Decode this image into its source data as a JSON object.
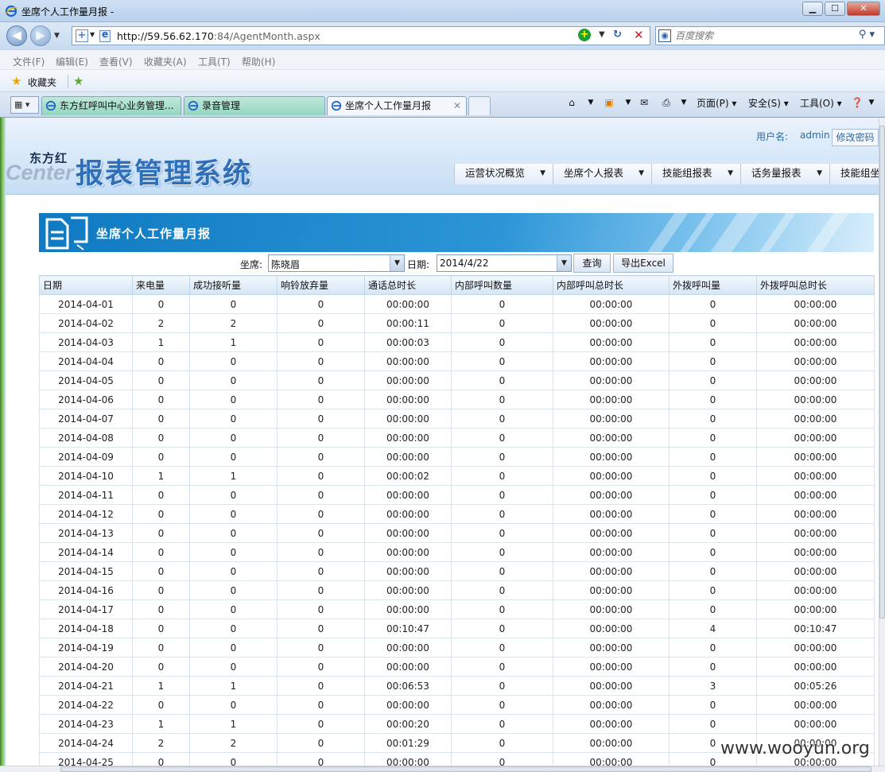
{
  "window": {
    "title": "坐席个人工作量月报 -",
    "min": "▁",
    "max": "☐",
    "close": "✕"
  },
  "address": {
    "url_host": "http://59.56.62.170",
    "url_rest": ":84/AgentMonth.aspx",
    "search_placeholder": "百度搜索"
  },
  "menu": [
    "文件(F)",
    "编辑(E)",
    "查看(V)",
    "收藏夹(A)",
    "工具(T)",
    "帮助(H)"
  ],
  "favorites": {
    "label": "收藏夹"
  },
  "tabs": [
    {
      "label": "东方红呼叫中心业务管理..."
    },
    {
      "label": "录音管理"
    },
    {
      "label": "坐席个人工作量月报"
    }
  ],
  "commands": {
    "page": "页面(P) ▾",
    "safety": "安全(S) ▾",
    "tools": "工具(O) ▾"
  },
  "header": {
    "logo_small": "东方红",
    "logo_center": "Center",
    "logo_main": "报表管理系统",
    "user_label": "用户名:",
    "user_name": "admin",
    "change_password": "修改密码",
    "nav": [
      "运营状况概览",
      "坐席个人报表",
      "技能组报表",
      "话务量报表",
      "技能组坐"
    ]
  },
  "banner": {
    "title": "坐席个人工作量月报"
  },
  "filter": {
    "agent_label": "坐席:",
    "agent_value": "陈晓眉",
    "date_label": "日期:",
    "date_value": "2014/4/22",
    "query_button": "查询",
    "export_button": "导出Excel"
  },
  "table": {
    "columns": [
      "日期",
      "来电量",
      "成功接听量",
      "响铃放弃量",
      "通话总时长",
      "内部呼叫数量",
      "内部呼叫总时长",
      "外拨呼叫量",
      "外拨呼叫总时长"
    ],
    "rows": [
      [
        "2014-04-01",
        "0",
        "0",
        "0",
        "00:00:00",
        "0",
        "00:00:00",
        "0",
        "00:00:00"
      ],
      [
        "2014-04-02",
        "2",
        "2",
        "0",
        "00:00:11",
        "0",
        "00:00:00",
        "0",
        "00:00:00"
      ],
      [
        "2014-04-03",
        "1",
        "1",
        "0",
        "00:00:03",
        "0",
        "00:00:00",
        "0",
        "00:00:00"
      ],
      [
        "2014-04-04",
        "0",
        "0",
        "0",
        "00:00:00",
        "0",
        "00:00:00",
        "0",
        "00:00:00"
      ],
      [
        "2014-04-05",
        "0",
        "0",
        "0",
        "00:00:00",
        "0",
        "00:00:00",
        "0",
        "00:00:00"
      ],
      [
        "2014-04-06",
        "0",
        "0",
        "0",
        "00:00:00",
        "0",
        "00:00:00",
        "0",
        "00:00:00"
      ],
      [
        "2014-04-07",
        "0",
        "0",
        "0",
        "00:00:00",
        "0",
        "00:00:00",
        "0",
        "00:00:00"
      ],
      [
        "2014-04-08",
        "0",
        "0",
        "0",
        "00:00:00",
        "0",
        "00:00:00",
        "0",
        "00:00:00"
      ],
      [
        "2014-04-09",
        "0",
        "0",
        "0",
        "00:00:00",
        "0",
        "00:00:00",
        "0",
        "00:00:00"
      ],
      [
        "2014-04-10",
        "1",
        "1",
        "0",
        "00:00:02",
        "0",
        "00:00:00",
        "0",
        "00:00:00"
      ],
      [
        "2014-04-11",
        "0",
        "0",
        "0",
        "00:00:00",
        "0",
        "00:00:00",
        "0",
        "00:00:00"
      ],
      [
        "2014-04-12",
        "0",
        "0",
        "0",
        "00:00:00",
        "0",
        "00:00:00",
        "0",
        "00:00:00"
      ],
      [
        "2014-04-13",
        "0",
        "0",
        "0",
        "00:00:00",
        "0",
        "00:00:00",
        "0",
        "00:00:00"
      ],
      [
        "2014-04-14",
        "0",
        "0",
        "0",
        "00:00:00",
        "0",
        "00:00:00",
        "0",
        "00:00:00"
      ],
      [
        "2014-04-15",
        "0",
        "0",
        "0",
        "00:00:00",
        "0",
        "00:00:00",
        "0",
        "00:00:00"
      ],
      [
        "2014-04-16",
        "0",
        "0",
        "0",
        "00:00:00",
        "0",
        "00:00:00",
        "0",
        "00:00:00"
      ],
      [
        "2014-04-17",
        "0",
        "0",
        "0",
        "00:00:00",
        "0",
        "00:00:00",
        "0",
        "00:00:00"
      ],
      [
        "2014-04-18",
        "0",
        "0",
        "0",
        "00:10:47",
        "0",
        "00:00:00",
        "4",
        "00:10:47"
      ],
      [
        "2014-04-19",
        "0",
        "0",
        "0",
        "00:00:00",
        "0",
        "00:00:00",
        "0",
        "00:00:00"
      ],
      [
        "2014-04-20",
        "0",
        "0",
        "0",
        "00:00:00",
        "0",
        "00:00:00",
        "0",
        "00:00:00"
      ],
      [
        "2014-04-21",
        "1",
        "1",
        "0",
        "00:06:53",
        "0",
        "00:00:00",
        "3",
        "00:05:26"
      ],
      [
        "2014-04-22",
        "0",
        "0",
        "0",
        "00:00:00",
        "0",
        "00:00:00",
        "0",
        "00:00:00"
      ],
      [
        "2014-04-23",
        "1",
        "1",
        "0",
        "00:00:20",
        "0",
        "00:00:00",
        "0",
        "00:00:00"
      ],
      [
        "2014-04-24",
        "2",
        "2",
        "0",
        "00:01:29",
        "0",
        "00:00:00",
        "0",
        "00:00:00"
      ],
      [
        "2014-04-25",
        "0",
        "0",
        "0",
        "00:00:00",
        "0",
        "00:00:00",
        "0",
        "00:00:00"
      ]
    ]
  },
  "watermark": "www.wooyun.org",
  "colors": {
    "banner": "#0f7ac2",
    "header_bg": "#c6def5",
    "logo": "#2f6fb7",
    "link": "#2c6aa6"
  }
}
